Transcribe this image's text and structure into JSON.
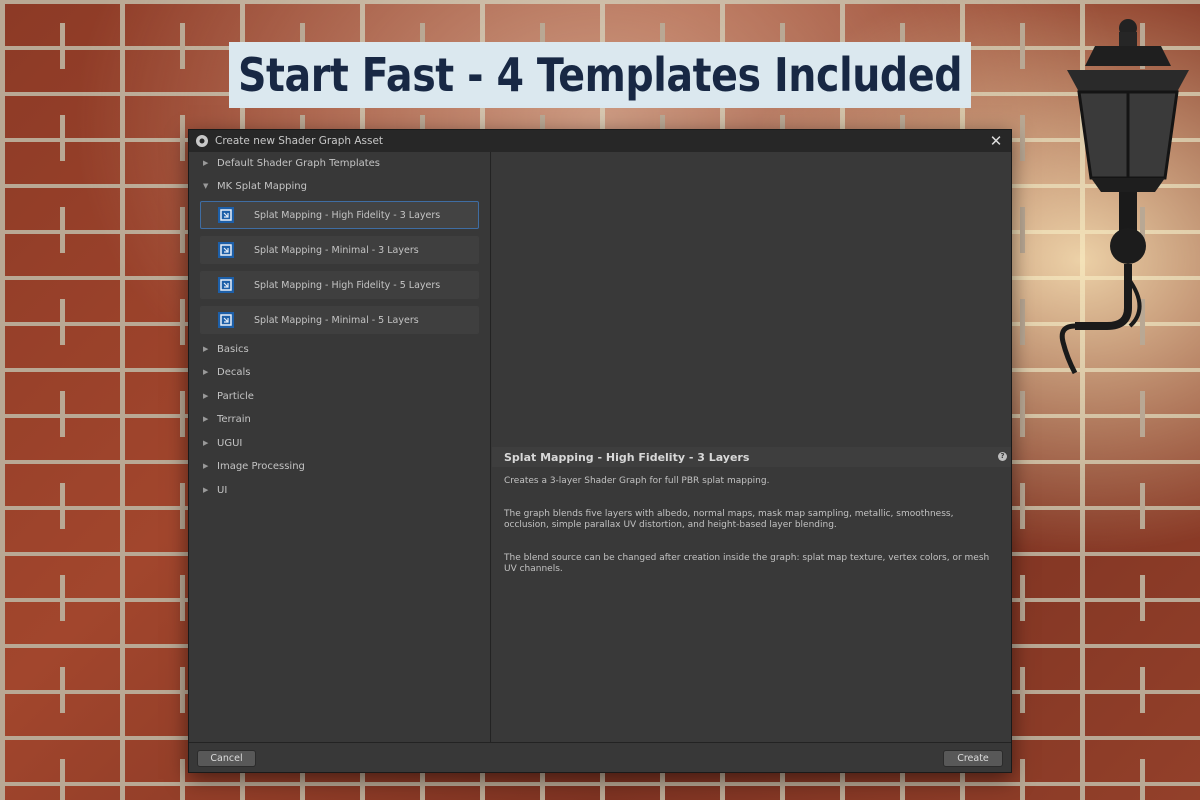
{
  "banner": {
    "headline": "Start Fast - 4 Templates Included"
  },
  "dialog": {
    "title": "Create new Shader Graph Asset",
    "close_icon": "close-icon",
    "tree": [
      {
        "label": "Default Shader Graph Templates",
        "expanded": false
      },
      {
        "label": "MK Splat Mapping",
        "expanded": true
      },
      {
        "label": "Basics",
        "expanded": false
      },
      {
        "label": "Decals",
        "expanded": false
      },
      {
        "label": "Particle",
        "expanded": false
      },
      {
        "label": "Terrain",
        "expanded": false
      },
      {
        "label": "UGUI",
        "expanded": false
      },
      {
        "label": "Image Processing",
        "expanded": false
      },
      {
        "label": "UI",
        "expanded": false
      }
    ],
    "templates": [
      {
        "label": "Splat Mapping - High Fidelity - 3 Layers",
        "selected": true
      },
      {
        "label": "Splat Mapping - Minimal - 3 Layers",
        "selected": false
      },
      {
        "label": "Splat Mapping - High Fidelity - 5 Layers",
        "selected": false
      },
      {
        "label": "Splat Mapping - Minimal - 5 Layers",
        "selected": false
      }
    ],
    "detail": {
      "title": "Splat Mapping - High Fidelity - 3 Layers",
      "help_icon": "help-icon",
      "paragraphs": [
        "Creates a 3-layer Shader Graph for full PBR splat mapping.",
        "The graph blends five layers with albedo, normal maps, mask map sampling, metallic, smoothness, occlusion, simple parallax UV distortion, and height-based layer blending.",
        "The blend source can be changed after creation inside the graph: splat map texture, vertex colors, or mesh UV channels."
      ]
    },
    "footer": {
      "cancel_label": "Cancel",
      "create_label": "Create"
    }
  },
  "colors": {
    "accent_selected_border": "#3f6da3",
    "headline_text": "#182844",
    "headline_bg": "#dbe8ef",
    "dialog_bg": "#383838"
  }
}
